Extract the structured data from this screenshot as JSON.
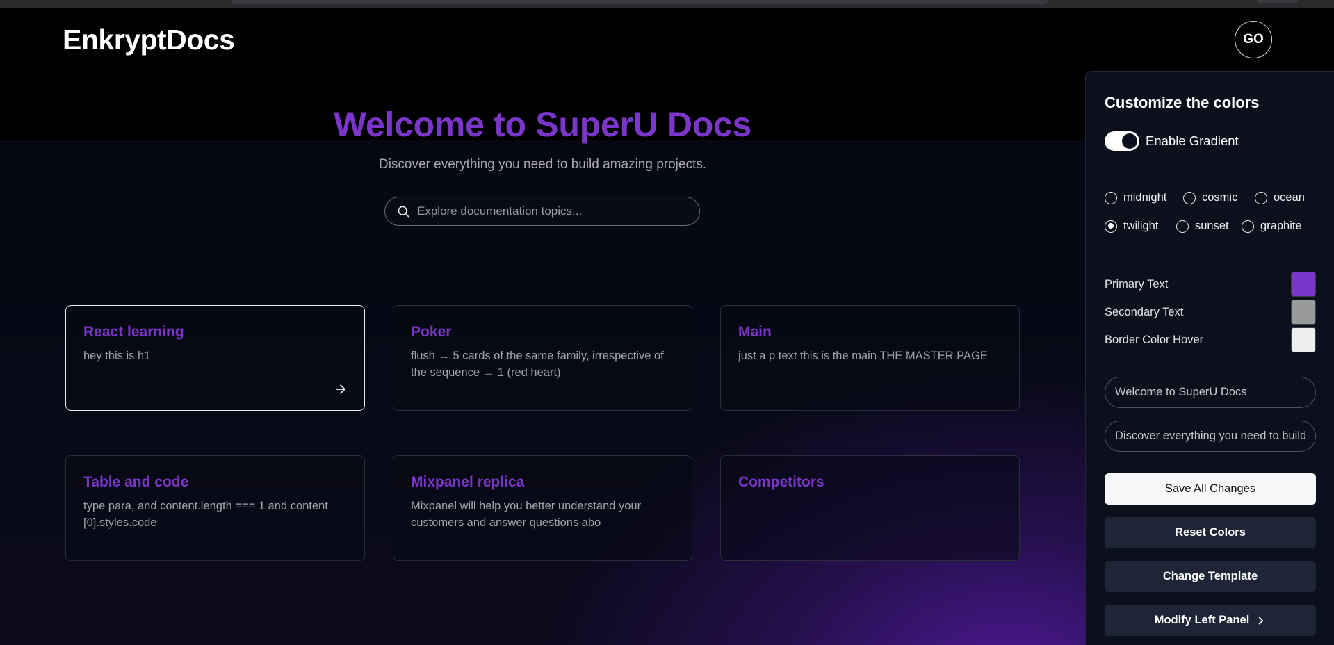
{
  "app": {
    "logo": "EnkryptDocs",
    "avatar_initials": "GO"
  },
  "hero": {
    "title": "Welcome to SuperU Docs",
    "subtitle": "Discover everything you need to build amazing projects.",
    "search_placeholder": "Explore documentation topics..."
  },
  "cards": [
    {
      "title": "React learning",
      "text": "hey this is h1"
    },
    {
      "title": "Poker",
      "text": "flush → 5 cards of the same family, irrespective of the sequence → 1 (red heart)"
    },
    {
      "title": "Main",
      "text": "just a p text this is the main THE MASTER PAGE"
    },
    {
      "title": "Table and code",
      "text": "type para, and content.length === 1 and content [0].styles.code"
    },
    {
      "title": "Mixpanel replica",
      "text": "Mixpanel will help you better understand your customers and answer questions abo"
    },
    {
      "title": "Competitors",
      "text": ""
    }
  ],
  "panel": {
    "title": "Customize the colors",
    "gradient_label": "Enable Gradient",
    "gradient_enabled": true,
    "themes": [
      "midnight",
      "cosmic",
      "ocean",
      "twilight",
      "sunset",
      "graphite"
    ],
    "selected_theme": "twilight",
    "colors": [
      {
        "label": "Primary Text",
        "value": "#7a35c9"
      },
      {
        "label": "Secondary Text",
        "value": "#9a9a9a"
      },
      {
        "label": "Border Color Hover",
        "value": "#eeeeee"
      }
    ],
    "title_input": "Welcome to SuperU Docs",
    "subtitle_input": "Discover everything you need to build amazing projects.",
    "buttons": {
      "save": "Save All Changes",
      "reset": "Reset Colors",
      "template": "Change Template",
      "left_panel": "Modify Left Panel"
    }
  },
  "colors": {
    "accent": "#7a35c9",
    "panel_bg": "#0c0f1c",
    "button_dark": "#1d2536"
  }
}
